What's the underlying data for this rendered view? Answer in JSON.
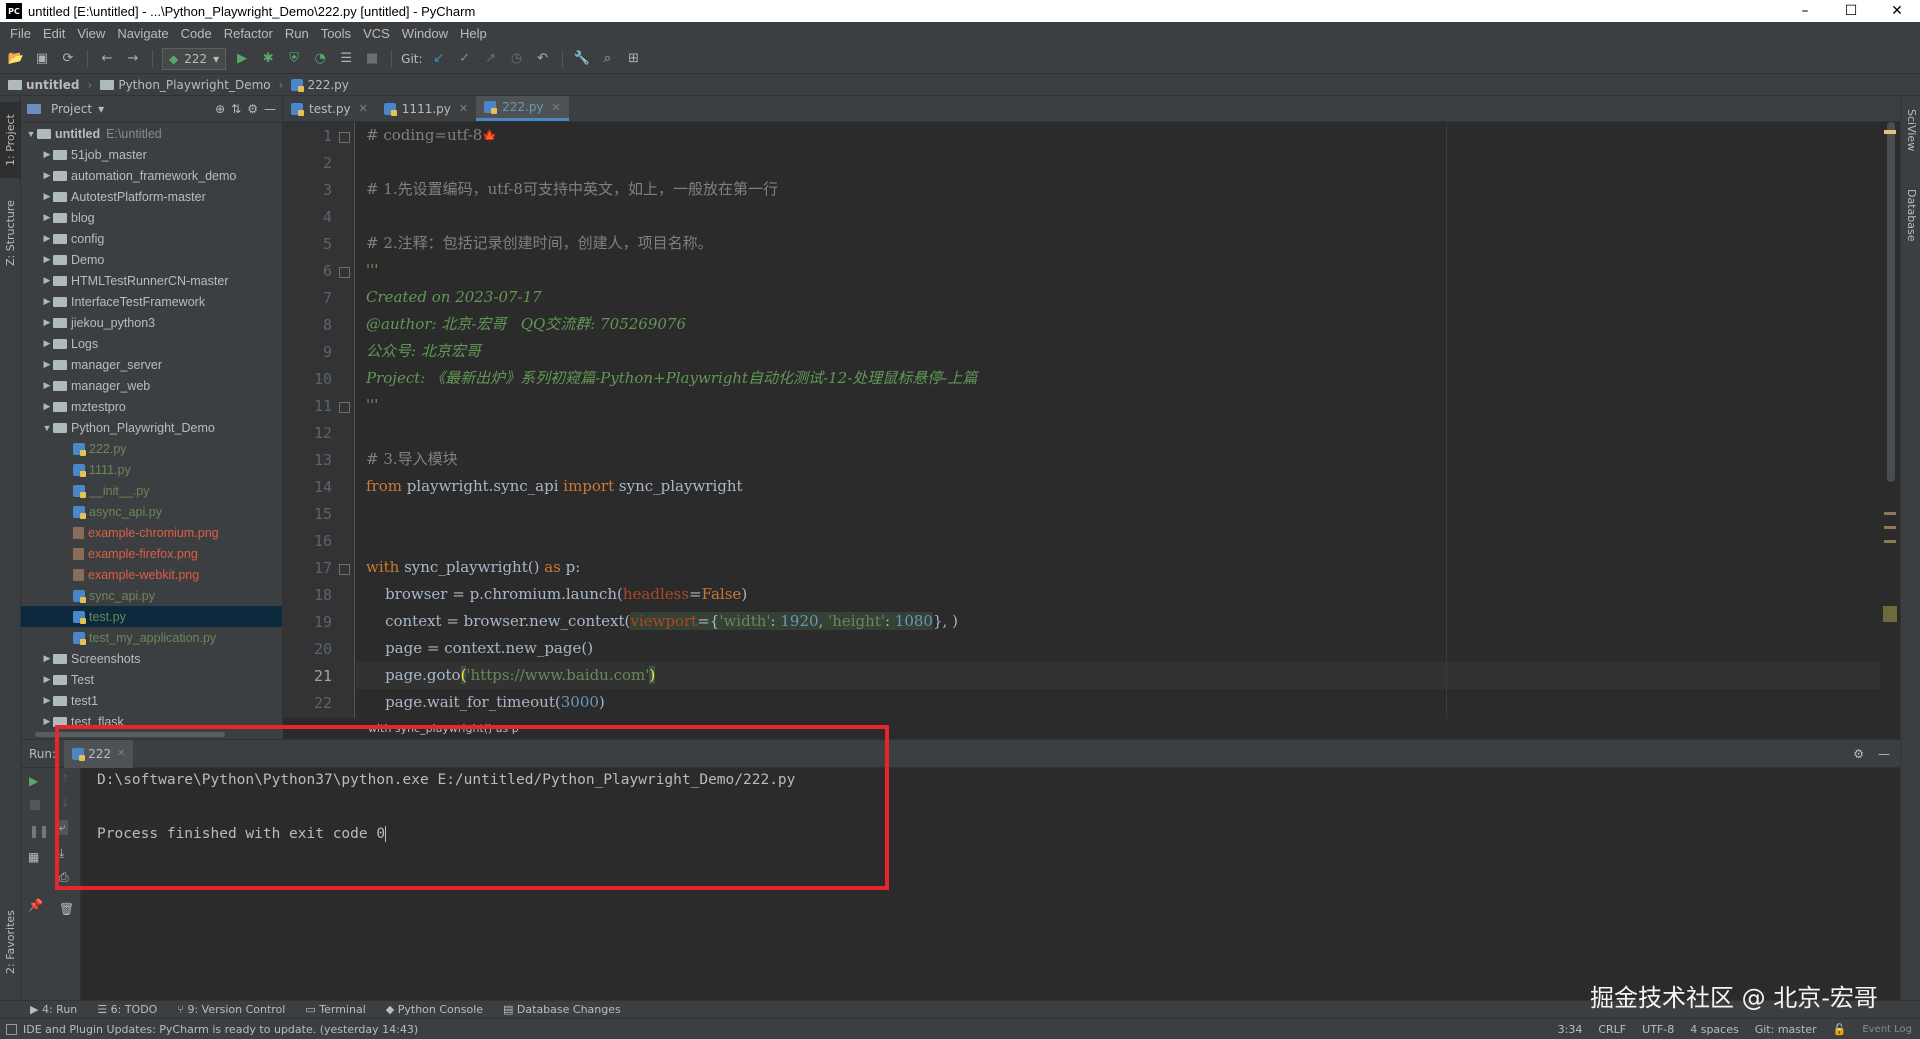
{
  "window": {
    "title": "untitled [E:\\untitled] - ...\\Python_Playwright_Demo\\222.py [untitled] - PyCharm",
    "logo": "PC",
    "minimize": "–",
    "maximize": "☐",
    "close": "✕"
  },
  "menu": [
    "File",
    "Edit",
    "View",
    "Navigate",
    "Code",
    "Refactor",
    "Run",
    "Tools",
    "VCS",
    "Window",
    "Help"
  ],
  "toolbar": {
    "run_config": "222",
    "git_label": "Git:"
  },
  "breadcrumb": {
    "root": "untitled",
    "folder": "Python_Playwright_Demo",
    "file": "222.py"
  },
  "left_stripe": {
    "project_tab": "1: Project",
    "structure_tab": "Z: Structure",
    "favorites_tab": "2: Favorites"
  },
  "right_stripe": {
    "sciview_tab": "SciView",
    "database_tab": "Database"
  },
  "project_panel": {
    "title": "Project",
    "root_label": "untitled",
    "root_path": "E:\\untitled",
    "items": [
      {
        "label": "51job_master",
        "type": "folder"
      },
      {
        "label": "automation_framework_demo",
        "type": "folder"
      },
      {
        "label": "AutotestPlatform-master",
        "type": "folder"
      },
      {
        "label": "blog",
        "type": "folder"
      },
      {
        "label": "config",
        "type": "folder"
      },
      {
        "label": "Demo",
        "type": "folder"
      },
      {
        "label": "HTMLTestRunnerCN-master",
        "type": "folder"
      },
      {
        "label": "InterfaceTestFramework",
        "type": "folder"
      },
      {
        "label": "jiekou_python3",
        "type": "folder"
      },
      {
        "label": "Logs",
        "type": "folder"
      },
      {
        "label": "manager_server",
        "type": "folder"
      },
      {
        "label": "manager_web",
        "type": "folder"
      },
      {
        "label": "mztestpro",
        "type": "folder"
      },
      {
        "label": "Python_Playwright_Demo",
        "type": "folder-open"
      },
      {
        "label": "222.py",
        "type": "py",
        "color": "#6a8759"
      },
      {
        "label": "1111.py",
        "type": "py",
        "color": "#6a8759"
      },
      {
        "label": "__init__.py",
        "type": "py",
        "color": "#6a8759"
      },
      {
        "label": "async_api.py",
        "type": "py",
        "color": "#6a8759"
      },
      {
        "label": "example-chromium.png",
        "type": "img",
        "color": "#e05d44"
      },
      {
        "label": "example-firefox.png",
        "type": "img",
        "color": "#e05d44"
      },
      {
        "label": "example-webkit.png",
        "type": "img",
        "color": "#e05d44"
      },
      {
        "label": "sync_api.py",
        "type": "py",
        "color": "#6a8759"
      },
      {
        "label": "test.py",
        "type": "py",
        "color": "#6a8759",
        "selected": true
      },
      {
        "label": "test_my_application.py",
        "type": "py",
        "color": "#6a8759"
      },
      {
        "label": "Screenshots",
        "type": "folder"
      },
      {
        "label": "Test",
        "type": "folder"
      },
      {
        "label": "test1",
        "type": "folder"
      },
      {
        "label": "test_flask",
        "type": "folder"
      }
    ]
  },
  "editor": {
    "tabs": [
      {
        "label": "test.py",
        "active": false
      },
      {
        "label": "1111.py",
        "active": false
      },
      {
        "label": "222.py",
        "active": true
      }
    ],
    "line_numbers": [
      "1",
      "2",
      "3",
      "4",
      "5",
      "6",
      "7",
      "8",
      "9",
      "10",
      "11",
      "12",
      "13",
      "14",
      "15",
      "16",
      "17",
      "18",
      "19",
      "20",
      "21",
      "22"
    ],
    "current_line": "21",
    "lines": {
      "l1": "# coding=utf-8",
      "l1_icon": "🍁",
      "l3": "# 1.先设置编码，utf-8可支持中英文，如上，一般放在第一行",
      "l5": "# 2.注释：包括记录创建时间，创建人，项目名称。",
      "l6": "'''",
      "l7": "Created on 2023-07-17",
      "l8": "@author: 北京-宏哥   QQ交流群: 705269076",
      "l9": "公众号: 北京宏哥",
      "l10": "Project: 《最新出炉》系列初窥篇-Python+Playwright自动化测试-12-处理鼠标悬停-上篇",
      "l11": "'''",
      "l13": "# 3.导入模块",
      "l14_from": "from",
      "l14_mod": " playwright.sync_api ",
      "l14_import": "import",
      "l14_name": " sync_playwright",
      "l17_with": "with",
      "l17_call": " sync_playwright() ",
      "l17_as": "as",
      "l17_p": " p:",
      "l18_a": "    browser = p.chromium.launch(",
      "l18_param": "headless",
      "l18_eq": "=",
      "l18_false": "False",
      "l18_close": ")",
      "l19_a": "    context = browser.new_context(",
      "l19_param": "viewport",
      "l19_eq": "={",
      "l19_k1": "'width'",
      "l19_c1": ": ",
      "l19_v1": "1920",
      "l19_c2": ", ",
      "l19_k2": "'height'",
      "l19_c3": ": ",
      "l19_v2": "1080",
      "l19_close": "}, )",
      "l20": "    page = context.new_page()",
      "l21_a": "    page.goto",
      "l21_open": "(",
      "l21_str": "'https://www.baidu.com'",
      "l21_close": ")",
      "l22_a": "    page.wait_for_timeout(",
      "l22_num": "3000",
      "l22_close": ")"
    },
    "code_breadcrumb": "with sync_playwright() as p"
  },
  "run_panel": {
    "label": "Run:",
    "tab": "222",
    "command": "D:\\software\\Python\\Python37\\python.exe E:/untitled/Python_Playwright_Demo/222.py",
    "result": "Process finished with exit code 0"
  },
  "bottom_tabs": [
    "4: Run",
    "6: TODO",
    "9: Version Control",
    "Terminal",
    "Python Console",
    "Database Changes"
  ],
  "status": {
    "message": "IDE and Plugin Updates: PyCharm is ready to update. (yesterday 14:43)",
    "position": "3:34",
    "line_sep": "CRLF",
    "encoding": "UTF-8",
    "indent": "4 spaces",
    "git": "Git: master",
    "event_log": "Event Log"
  },
  "watermark": "掘金技术社区 @ 北京-宏哥",
  "colors": {
    "highlight_box": "#e5262d",
    "background": "#2b2b2b",
    "panel": "#3c3f41"
  }
}
